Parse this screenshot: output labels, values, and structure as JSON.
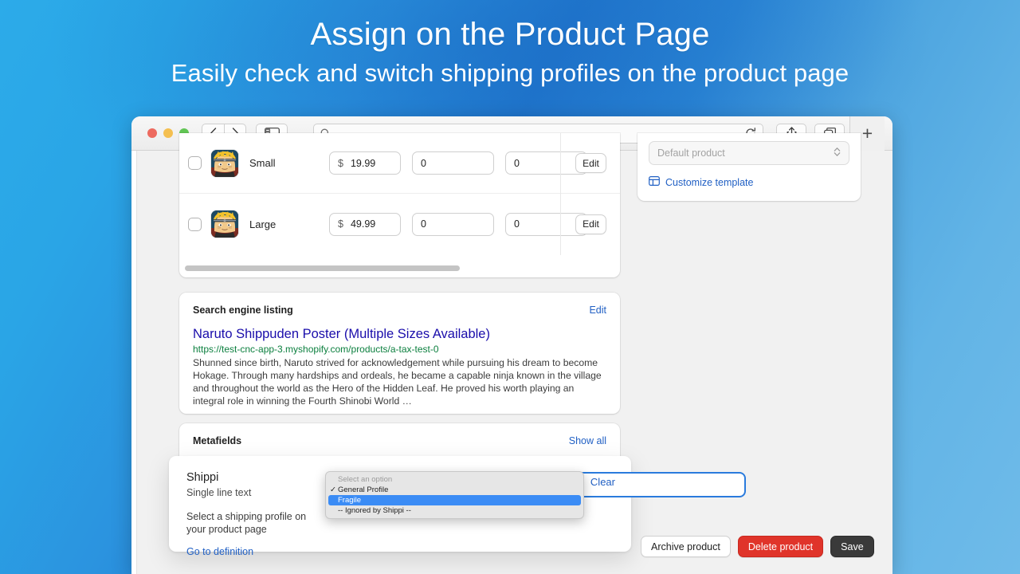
{
  "header": {
    "title": "Assign on the Product Page",
    "subtitle": "Easily check and switch shipping profiles on the product page"
  },
  "browser": {
    "traffic_lights": [
      "close",
      "minimize",
      "zoom"
    ],
    "back_label": "‹",
    "forward_label": "›",
    "sidebar_icon": "sidebar-icon",
    "url_value": "",
    "url_placeholder": "",
    "search_icon": "search-icon",
    "reload_icon": "reload-icon",
    "share_icon": "share-icon",
    "tabs_icon": "tab-overview-icon",
    "newtab_label": "+"
  },
  "variants": {
    "rows": [
      {
        "name": "Small",
        "currency": "$",
        "price": "19.99",
        "qty1": "0",
        "qty2": "0",
        "edit_label": "Edit"
      },
      {
        "name": "Large",
        "currency": "$",
        "price": "49.99",
        "qty1": "0",
        "qty2": "0",
        "edit_label": "Edit"
      }
    ]
  },
  "seo": {
    "card_title": "Search engine listing",
    "edit_label": "Edit",
    "title": "Naruto Shippuden Poster (Multiple Sizes Available)",
    "url": "https://test-cnc-app-3.myshopify.com/products/a-tax-test-0",
    "description": "Shunned since birth, Naruto strived for acknowledgement while pursuing his dream to become Hokage. Through many hardships and ordeals, he became a capable ninja known in the village and throughout the world as the Hero of the Hidden Leaf. He proved his worth playing an integral role in winning the Fourth Shinobi World …"
  },
  "metafields": {
    "card_title": "Metafields",
    "show_all_label": "Show all"
  },
  "shippi": {
    "name": "Shippi",
    "type": "Single line text",
    "help": "Select a shipping profile on your product page",
    "definition_link": "Go to definition",
    "clear_label": "Clear",
    "dropdown": {
      "header": "Select an option",
      "options": [
        {
          "label": "General Profile",
          "checked": true,
          "selected": false
        },
        {
          "label": "Fragile",
          "checked": false,
          "selected": true
        },
        {
          "label": "-- Ignored by Shippi --",
          "checked": false,
          "selected": false
        }
      ]
    }
  },
  "template": {
    "selected": "Default product",
    "chevron_icon": "chevron-updown-icon",
    "customize_label": "Customize template",
    "customize_icon": "template-icon"
  },
  "footer": {
    "archive_label": "Archive product",
    "delete_label": "Delete product",
    "save_label": "Save"
  },
  "colors": {
    "bg_start": "#2cabe9",
    "bg_mid": "#2179cf",
    "bg_end": "#6fbbe9",
    "link": "#2160c4",
    "seo_title": "#1a0dab",
    "seo_url": "#0b7f3e",
    "danger": "#e0342a",
    "save": "#3a3a3a",
    "dropdown_highlight": "#3b8cf5"
  }
}
